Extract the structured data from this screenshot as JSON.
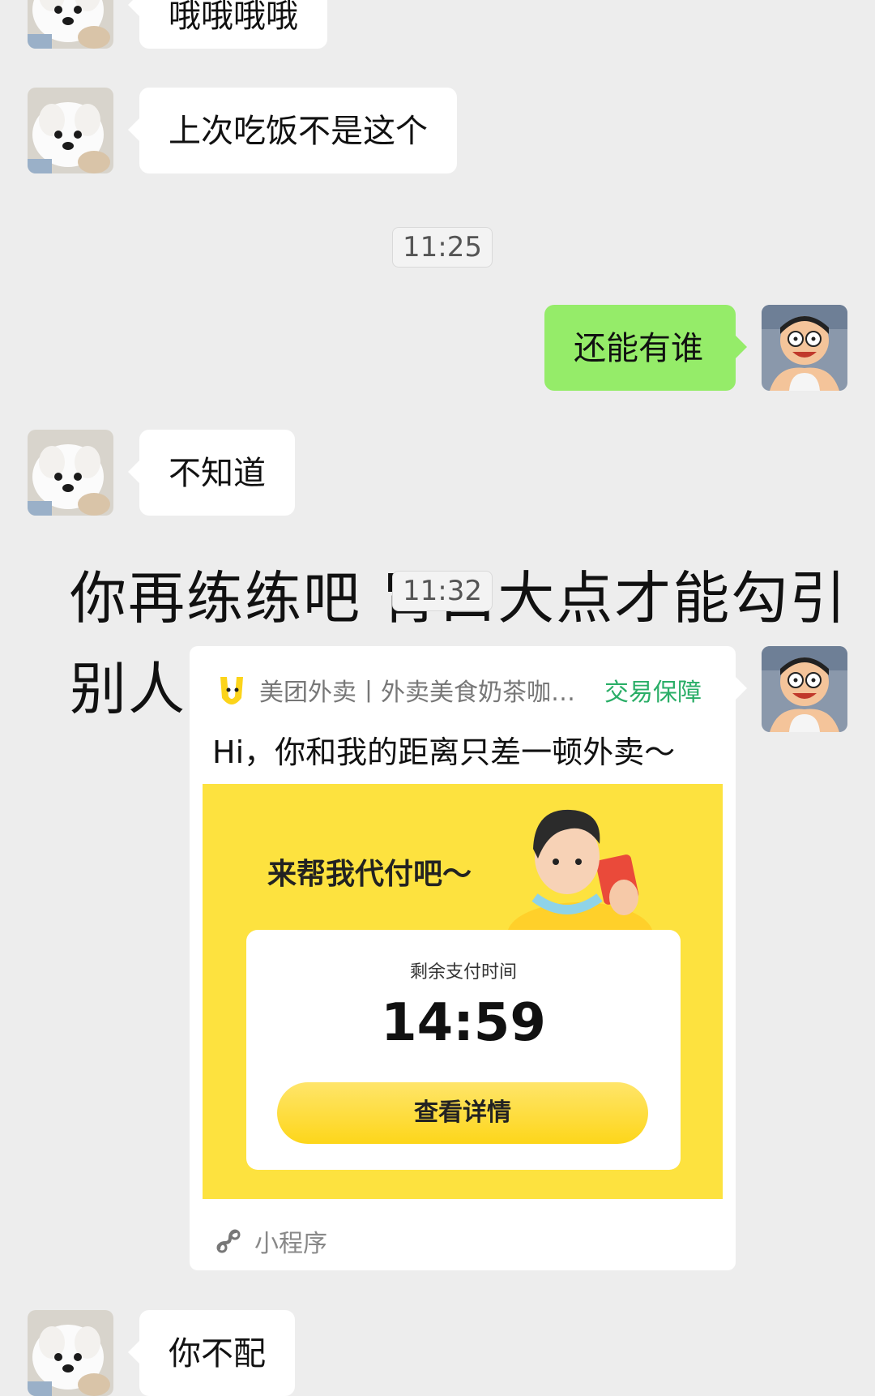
{
  "messages": {
    "m1": "哦哦哦哦",
    "m2": "上次吃饭不是这个",
    "time1": "11:25",
    "m3": "还能有谁",
    "m4": "不知道",
    "time2": "11:32",
    "m5": "你不配"
  },
  "overlay": {
    "line1": "你再练练吧 胃口大点才能勾引",
    "line2": "别人"
  },
  "mini_program": {
    "source": "美团外卖丨外卖美食奶茶咖啡...",
    "badge": "交易保障",
    "title": "Hi，你和我的距离只差一顿外卖～",
    "promo_text": "来帮我代付吧～",
    "countdown_label": "剩余支付时间",
    "countdown": "14:59",
    "button": "查看详情",
    "footer": "小程序",
    "badge_color": "#2aae67",
    "promo_color": "#fde23f"
  },
  "colors": {
    "sent_bubble": "#95ec69",
    "received_bubble": "#ffffff",
    "background": "#ededed"
  }
}
